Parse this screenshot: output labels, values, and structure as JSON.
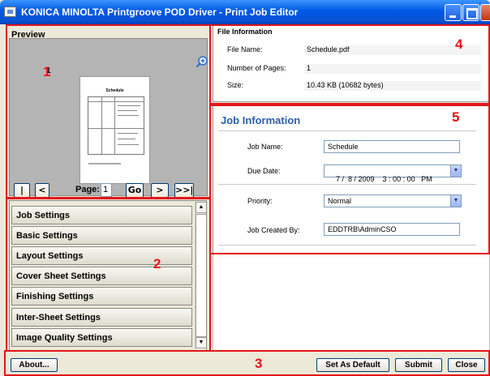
{
  "window": {
    "title": "KONICA MINOLTA Printgroove POD Driver - Print Job Editor"
  },
  "preview": {
    "group_label": "Preview",
    "page_number": "1",
    "thumbnail_title": "Schedule",
    "nav": {
      "first": "|<<",
      "prev": "<",
      "page_label": "Page:",
      "page_value": "1",
      "go": "Go",
      "next": ">",
      "last": ">>|"
    }
  },
  "settings_list": {
    "items": [
      "Job Settings",
      "Basic Settings",
      "Layout Settings",
      "Cover Sheet Settings",
      "Finishing Settings",
      "Inter-Sheet Settings",
      "Image Quality Settings"
    ]
  },
  "file_info": {
    "group_label": "File Information",
    "rows": [
      {
        "label": "File Name:",
        "value": "Schedule.pdf"
      },
      {
        "label": "Number of Pages:",
        "value": "1"
      },
      {
        "label": "Size:",
        "value": "10.43 KB (10682 bytes)"
      }
    ]
  },
  "job_info": {
    "title": "Job Information",
    "job_name": {
      "label": "Job Name:",
      "value": "Schedule"
    },
    "due_date": {
      "label": "Due Date:",
      "value": "7 /  8 / 2009    3 : 00 : 00   PM"
    },
    "priority": {
      "label": "Priority:",
      "value": "Normal"
    },
    "created_by": {
      "label": "Job Created By:",
      "value": "EDDTRB\\AdminCSO"
    }
  },
  "buttons": {
    "about": "About...",
    "set_default": "Set As Default",
    "submit": "Submit",
    "close": "Close"
  },
  "markers": [
    "1",
    "2",
    "3",
    "4",
    "5"
  ]
}
